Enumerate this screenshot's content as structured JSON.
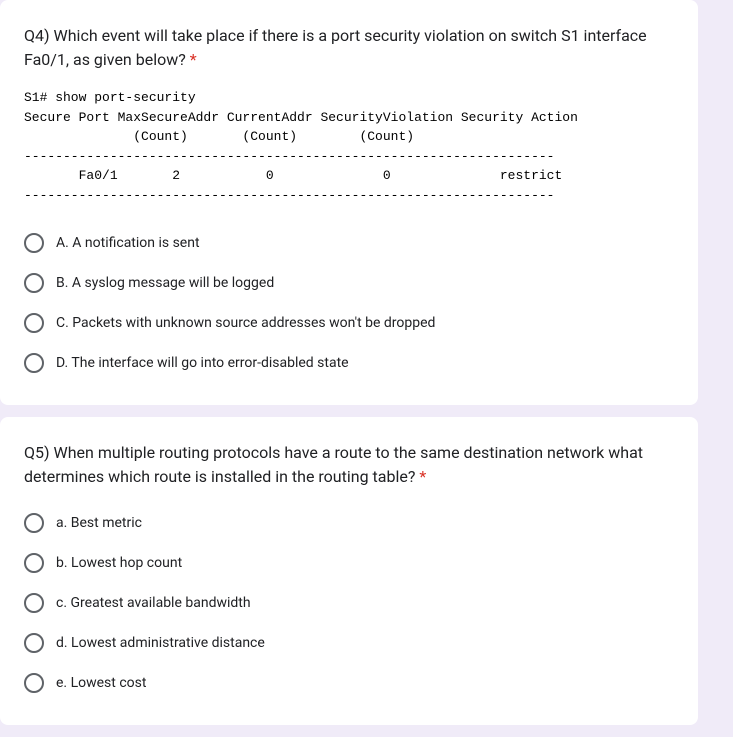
{
  "q4": {
    "title": "Q4) Which event will take place if there is a port security violation on switch S1 interface Fa0/1, as given below?",
    "required": "*",
    "cli": "S1# show port-security\nSecure Port MaxSecureAddr CurrentAddr SecurityViolation Security Action\n              (Count)       (Count)        (Count)\n--------------------------------------------------------------------\n       Fa0/1       2           0              0              restrict\n--------------------------------------------------------------------",
    "options": [
      "A. A notification is sent",
      "B. A syslog message will be logged",
      "C. Packets with unknown source addresses won't be dropped",
      "D. The interface will go into error-disabled state"
    ]
  },
  "q5": {
    "title": "Q5) When multiple routing protocols have a route to the same destination network what determines which route is installed in the routing table?",
    "required": "*",
    "options": [
      "a. Best metric",
      "b. Lowest hop count",
      "c. Greatest available bandwidth",
      "d. Lowest administrative distance",
      "e. Lowest cost"
    ]
  }
}
